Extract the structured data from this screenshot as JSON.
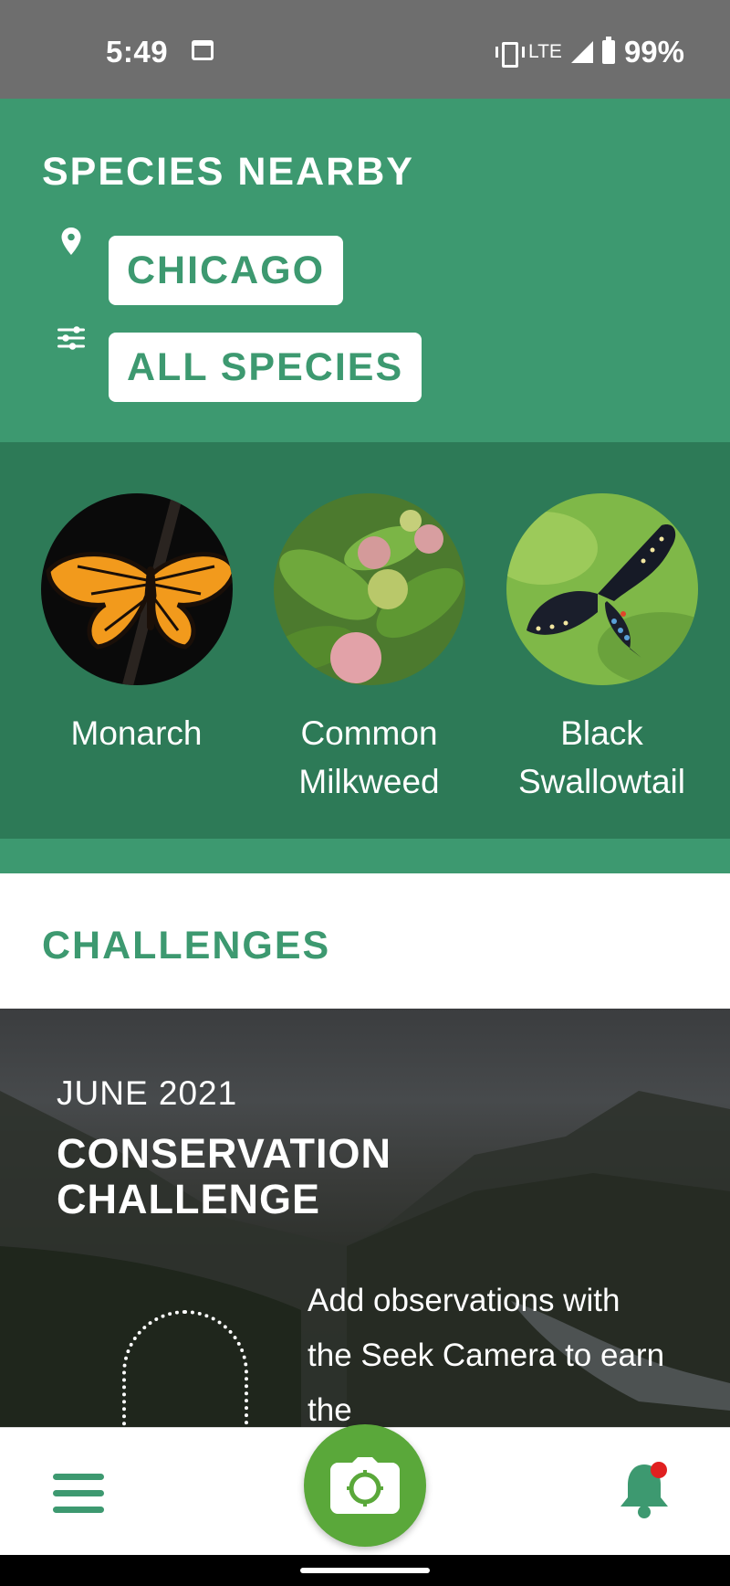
{
  "status_bar": {
    "time": "5:49",
    "network": "LTE",
    "battery": "99%"
  },
  "species_nearby": {
    "title": "SPECIES NEARBY",
    "location_label": "CHICAGO",
    "filter_label": "ALL SPECIES",
    "species": [
      {
        "name": "Monarch",
        "icon": "monarch-butterfly-photo"
      },
      {
        "name": "Common Milkweed",
        "icon": "milkweed-plant-photo"
      },
      {
        "name": "Black Swallowtail",
        "icon": "swallowtail-butterfly-photo"
      }
    ]
  },
  "challenges": {
    "title": "CHALLENGES",
    "card": {
      "month": "JUNE 2021",
      "title_line1": "CONSERVATION",
      "title_line2": "CHALLENGE",
      "description": "Add observations with the Seek Camera to earn the"
    }
  },
  "bottom_nav": {
    "menu_icon": "hamburger-menu-icon",
    "camera_icon": "camera-icon",
    "bell_icon": "notification-bell-icon"
  },
  "colors": {
    "brand_green": "#3d9970",
    "dark_green": "#2d7a57",
    "camera_green": "#5aa83a",
    "notification_dot": "#e02020"
  }
}
